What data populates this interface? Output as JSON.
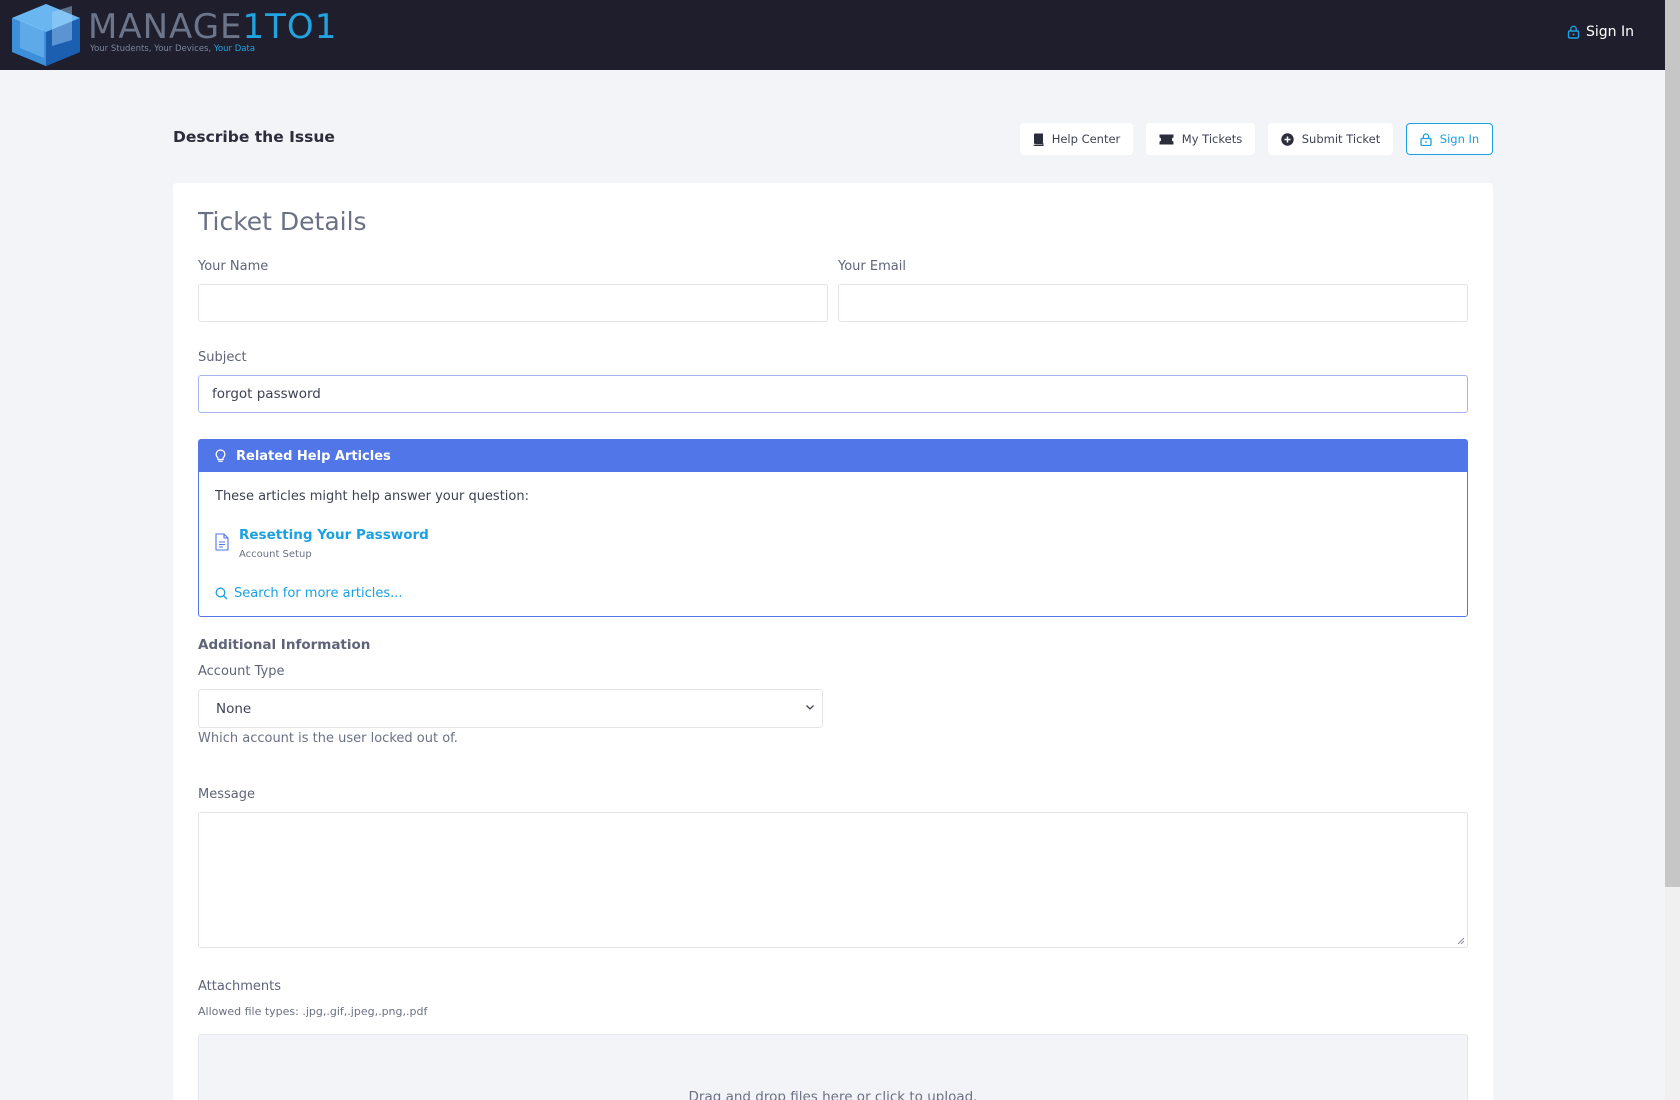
{
  "header": {
    "logo_word": "MANAGE",
    "logo_number": "1TO1",
    "logo_tagline": "Your Students, Your Devices,",
    "logo_tagline_highlight": "Your Data",
    "signin_label": "Sign In"
  },
  "page": {
    "title": "Describe the Issue",
    "nav": [
      {
        "label": "Help Center",
        "icon": "book-icon"
      },
      {
        "label": "My Tickets",
        "icon": "ticket-icon"
      },
      {
        "label": "Submit Ticket",
        "icon": "plus-circle-icon"
      },
      {
        "label": "Sign In",
        "icon": "lock-icon"
      }
    ]
  },
  "form": {
    "card_title": "Ticket Details",
    "name_label": "Your Name",
    "name_value": "",
    "email_label": "Your Email",
    "email_value": "",
    "subject_label": "Subject",
    "subject_value": "forgot password",
    "related": {
      "title": "Related Help Articles",
      "intro": "These articles might help answer your question:",
      "articles": [
        {
          "title": "Resetting Your Password",
          "category": "Account Setup"
        }
      ],
      "search_more": "Search for more articles..."
    },
    "additional_info_title": "Additional Information",
    "account_type_label": "Account Type",
    "account_type_value": "None",
    "account_type_help": "Which account is the user locked out of.",
    "message_label": "Message",
    "message_value": "",
    "attachments_label": "Attachments",
    "allowed_types": "Allowed file types: .jpg,.gif,.jpeg,.png,.pdf",
    "dropzone_text": "Drag and drop files here or click to upload."
  },
  "colors": {
    "topbar": "#1e1e2d",
    "accent": "#1ba0e2",
    "related_header": "#5176e8",
    "background": "#f3f4f7"
  }
}
